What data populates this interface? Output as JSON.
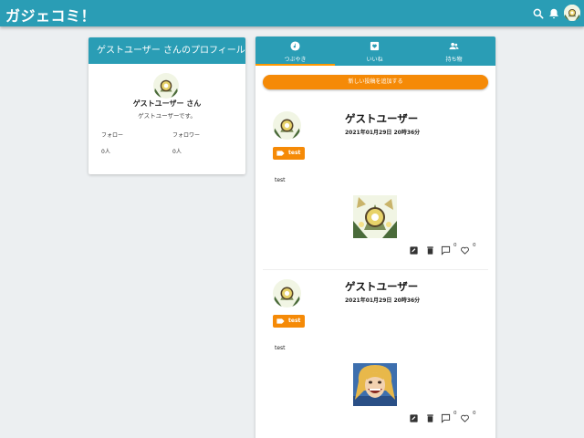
{
  "app": {
    "title": "ガジェコミ！"
  },
  "header": {
    "search_icon": "search-icon",
    "bell_icon": "bell-icon",
    "avatar": "user-avatar"
  },
  "profile": {
    "title": "ゲストユーザー さんのプロフィール",
    "name": "ゲストユーザー さん",
    "bio": "ゲストユーザーです。",
    "follow_label": "フォロー",
    "follower_label": "フォロワー",
    "follow_count": "0人",
    "follower_count": "0人"
  },
  "tabs": [
    {
      "label": "つぶやき",
      "icon": "music-note-icon",
      "active": true
    },
    {
      "label": "いいね",
      "icon": "heart-box-icon",
      "active": false
    },
    {
      "label": "持ち物",
      "icon": "people-icon",
      "active": false
    }
  ],
  "add_post_label": "新しい投稿を追加する",
  "posts": [
    {
      "user": "ゲストユーザー",
      "date": "2021年01月29日 20時36分",
      "tag": "test",
      "body": "test",
      "comments": "0",
      "likes": "0"
    },
    {
      "user": "ゲストユーザー",
      "date": "2021年01月29日 20時36分",
      "tag": "test",
      "body": "test",
      "comments": "0",
      "likes": "0"
    }
  ],
  "colors": {
    "primary": "#2a9db5",
    "accent": "#f58a07",
    "background": "#eceff1"
  }
}
